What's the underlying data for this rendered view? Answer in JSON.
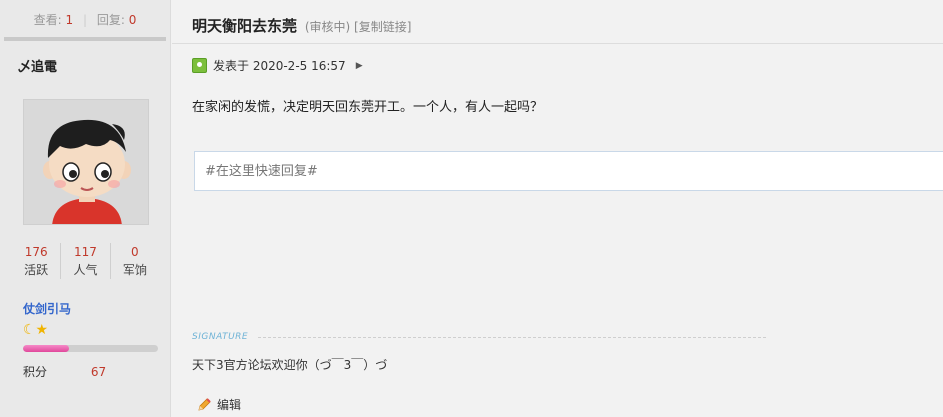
{
  "stats_header": {
    "views_label": "查看:",
    "views_value": "1",
    "separator": "|",
    "replies_label": "回复:",
    "replies_value": "0"
  },
  "author": {
    "name": "乄追電",
    "avatar_icon": "cartoon-boy-avatar-icon",
    "stats": [
      {
        "value": "176",
        "label": "活跃"
      },
      {
        "value": "117",
        "label": "人气"
      },
      {
        "value": "0",
        "label": "军饷"
      }
    ],
    "group": "仗剑引马",
    "rank_icons": [
      "moon-icon",
      "star-icon"
    ],
    "rank_glyphs": "☾★",
    "level_progress": 0.34,
    "credit_label": "积分",
    "credit_value": "67"
  },
  "post": {
    "title": "明天衡阳去东莞",
    "status": "(审核中)",
    "copy_link": "[复制链接]",
    "posted_at": "发表于 2020-2-5 16:57",
    "body": "在家闲的发慌，决定明天回东莞开工。一个人，有人一起吗？",
    "reply_placeholder": "#在这里快速回复#",
    "signature_label": "SIGNATURE",
    "signature_text": "天下3官方论坛欢迎你（づ￣3￣）づ",
    "edit_label": "编辑"
  },
  "colors": {
    "accent_red": "#c0392b",
    "group_blue": "#3366cc",
    "progress_pink": "#e0489b"
  }
}
